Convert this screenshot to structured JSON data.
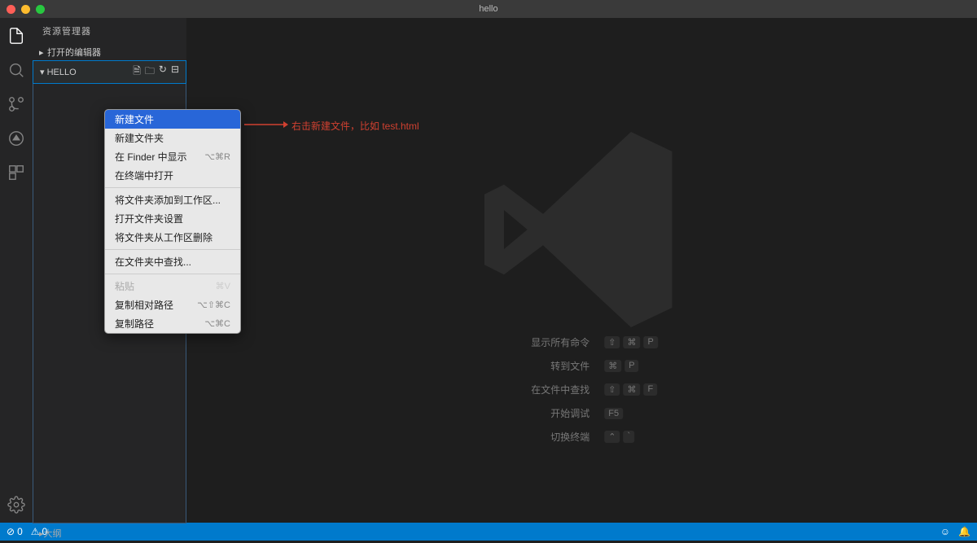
{
  "title": "hello",
  "sidebar": {
    "title": "资源管理器",
    "open_editors": "打开的编辑器",
    "folder": "HELLO",
    "outline": "大纲"
  },
  "context_menu": {
    "items": [
      {
        "label": "新建文件",
        "shortcut": "",
        "selected": true
      },
      {
        "label": "新建文件夹",
        "shortcut": ""
      },
      {
        "label": "在 Finder 中显示",
        "shortcut": "⌥⌘R"
      },
      {
        "label": "在终端中打开",
        "shortcut": ""
      }
    ],
    "items2": [
      {
        "label": "将文件夹添加到工作区...",
        "shortcut": ""
      },
      {
        "label": "打开文件夹设置",
        "shortcut": ""
      },
      {
        "label": "将文件夹从工作区删除",
        "shortcut": ""
      }
    ],
    "items3": [
      {
        "label": "在文件夹中查找...",
        "shortcut": ""
      }
    ],
    "items4": [
      {
        "label": "粘贴",
        "shortcut": "⌘V",
        "disabled": true
      },
      {
        "label": "复制相对路径",
        "shortcut": "⌥⇧⌘C"
      },
      {
        "label": "复制路径",
        "shortcut": "⌥⌘C"
      }
    ]
  },
  "annotation": "右击新建文件，比如 test.html",
  "hints": [
    {
      "label": "显示所有命令",
      "keys": [
        "⇧",
        "⌘",
        "P"
      ]
    },
    {
      "label": "转到文件",
      "keys": [
        "⌘",
        "P"
      ]
    },
    {
      "label": "在文件中查找",
      "keys": [
        "⇧",
        "⌘",
        "F"
      ]
    },
    {
      "label": "开始调试",
      "keys": [
        "F5"
      ]
    },
    {
      "label": "切换终端",
      "keys": [
        "⌃",
        "`"
      ]
    }
  ],
  "statusbar": {
    "errors": "0",
    "warnings": "0"
  }
}
